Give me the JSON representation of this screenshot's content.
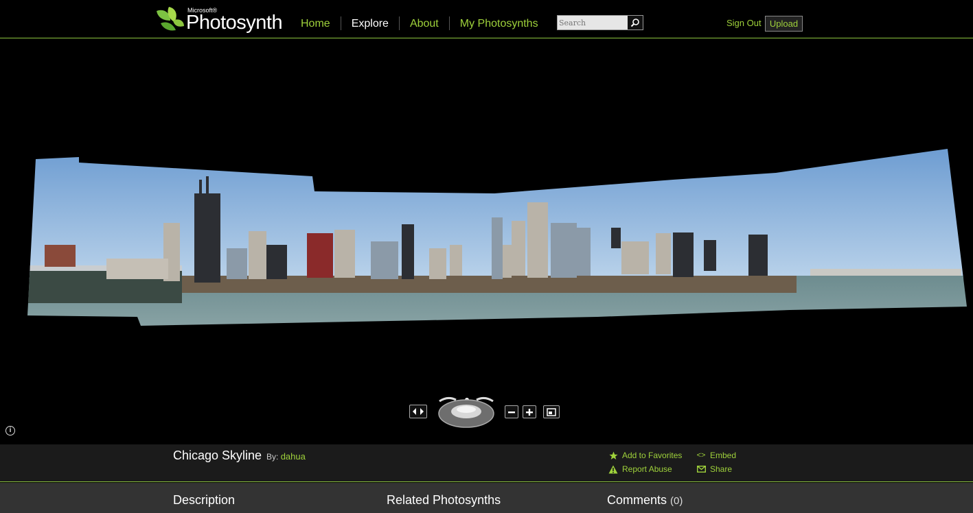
{
  "header": {
    "logo_small": "Microsoft®",
    "logo_brand": "Photosynth",
    "nav": [
      {
        "label": "Home",
        "active": false
      },
      {
        "label": "Explore",
        "active": true
      },
      {
        "label": "About",
        "active": false
      },
      {
        "label": "My Photosynths",
        "active": false
      }
    ],
    "search": {
      "placeholder": "Search",
      "value": ""
    },
    "sign_out": "Sign Out",
    "upload": "Upload"
  },
  "synth": {
    "title": "Chicago Skyline",
    "by_label": "By:",
    "author": "dahua",
    "actions": {
      "favorites": "Add to Favorites",
      "embed": "Embed",
      "report": "Report Abuse",
      "share": "Share"
    }
  },
  "tabs": {
    "description": "Description",
    "related": "Related Photosynths",
    "comments": "Comments",
    "comments_count": "(0)"
  },
  "colors": {
    "accent": "#9fd23b",
    "background": "#000000",
    "titlebar": "#1b1b1b",
    "tabbar": "#333333"
  }
}
